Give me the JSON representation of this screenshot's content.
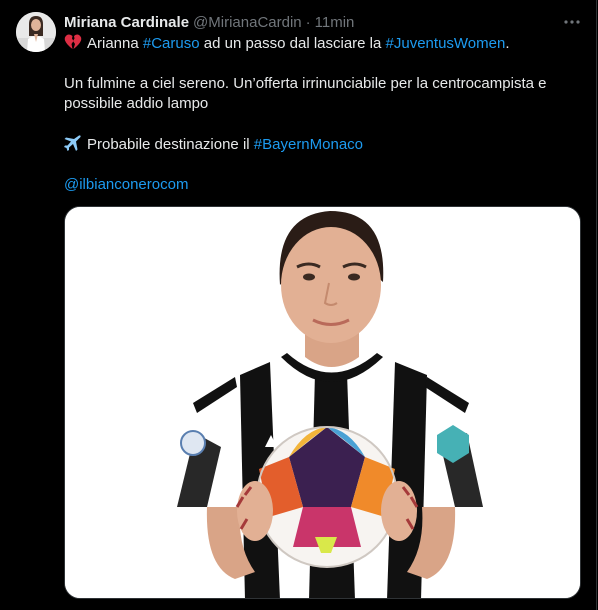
{
  "author": {
    "display_name": "Miriana Cardinale",
    "handle": "@MirianaCardin",
    "separator": "·",
    "time": "11min"
  },
  "tweet": {
    "line1_pre": "Arianna ",
    "line1_hashtag1": "#Caruso",
    "line1_mid": " ad un passo dal lasciare la ",
    "line1_hashtag2": "#JuventusWomen",
    "line1_post": ".",
    "line2": "Un fulmine a ciel sereno. Un’offerta irrinunciabile per la centrocampista e",
    "line3": "possibile addio lampo",
    "line4_pre": "Probabile destinazione il ",
    "line4_hashtag": "#BayernMonaco",
    "mention": "@ilbianconerocom"
  },
  "icons": {
    "line1_emoji": "broken-heart-icon",
    "line4_emoji": "airplane-icon",
    "more": "more-horizontal-icon"
  },
  "colors": {
    "background": "#000000",
    "text": "#e7e9ea",
    "secondary": "#71767b",
    "link": "#1d9bf0"
  }
}
